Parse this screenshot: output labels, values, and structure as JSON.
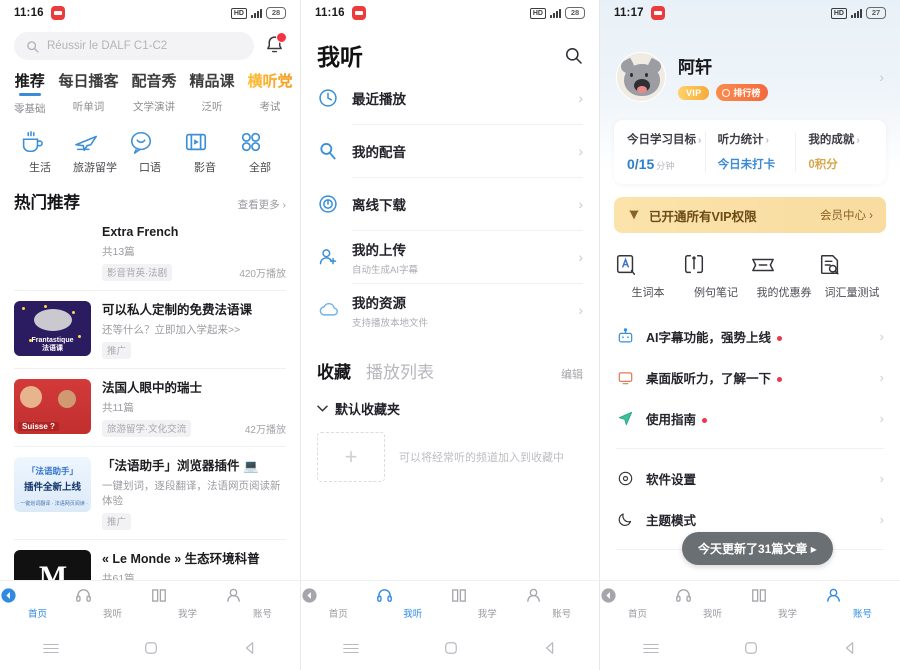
{
  "screens": [
    {
      "statusbar": {
        "time": "11:16",
        "hd": "HD",
        "battery": "28"
      },
      "search": {
        "placeholder": "Réussir le DALF C1-C2"
      },
      "tabs": [
        {
          "label": "推荐",
          "sub": "零基础",
          "active": true
        },
        {
          "label": "每日播客",
          "sub": "听单词",
          "active": false
        },
        {
          "label": "配音秀",
          "sub": "文学演讲",
          "active": false
        },
        {
          "label": "精品课",
          "sub": "泛听",
          "active": false
        },
        {
          "label": "横听党",
          "sub": "考试",
          "active": false,
          "promo": true
        }
      ],
      "categories": [
        {
          "label": "生活",
          "icon": "cup-icon"
        },
        {
          "label": "旅游留学",
          "icon": "plane-icon"
        },
        {
          "label": "口语",
          "icon": "speech-bubble-icon"
        },
        {
          "label": "影音",
          "icon": "film-icon"
        },
        {
          "label": "全部",
          "icon": "grid-icon"
        }
      ],
      "section": {
        "title": "热门推荐",
        "more": "查看更多"
      },
      "items": [
        {
          "title": "Extra French",
          "sub": "共13篇",
          "chip": "影音背英·法剧",
          "plays": "420万播放",
          "thumb": "th-extra"
        },
        {
          "title": "可以私人定制的免费法语课",
          "sub": "还等什么？立即加入学起来>>",
          "chip": "推广",
          "plays": "",
          "thumb": "th-frant"
        },
        {
          "title": "法国人眼中的瑞士",
          "sub": "共11篇",
          "chip": "旅游留学·文化交流",
          "plays": "42万播放",
          "thumb": "th-suisse"
        },
        {
          "title": "「法语助手」浏览器插件 💻",
          "sub": "一键划词，逐段翻译，法语网页阅读新体验",
          "chip": "推广",
          "plays": "",
          "thumb": "th-plugin"
        },
        {
          "title": "« Le Monde » 生态环境科普",
          "sub": "共61篇",
          "chip": "",
          "plays": "",
          "thumb": "th-monde"
        }
      ],
      "bottomnav": [
        {
          "label": "首页",
          "icon": "home-icon",
          "active": true
        },
        {
          "label": "我听",
          "icon": "headphone-icon",
          "active": false
        },
        {
          "label": "我学",
          "icon": "book-icon",
          "active": false
        },
        {
          "label": "账号",
          "icon": "person-icon",
          "active": false
        }
      ]
    },
    {
      "statusbar": {
        "time": "11:16",
        "hd": "HD",
        "battery": "28"
      },
      "title": "我听",
      "search_icon": "search-icon",
      "menu": [
        {
          "label": "最近播放",
          "sub": "",
          "icon": "clock-icon"
        },
        {
          "label": "我的配音",
          "sub": "",
          "icon": "mic-search-icon"
        },
        {
          "label": "离线下载",
          "sub": "",
          "icon": "download-circle-icon"
        },
        {
          "label": "我的上传",
          "sub": "自动生成AI字幕",
          "icon": "user-upload-icon"
        },
        {
          "label": "我的资源",
          "sub": "支持播放本地文件",
          "icon": "cloud-icon"
        }
      ],
      "fav": {
        "tab1": "收藏",
        "tab2": "播放列表",
        "edit": "编辑",
        "folder": "默认收藏夹",
        "empty_text": "可以将经常听的频道加入到收藏中",
        "add": "+"
      },
      "bottomnav": [
        {
          "label": "首页",
          "icon": "home-icon",
          "active": false
        },
        {
          "label": "我听",
          "icon": "headphone-icon",
          "active": true
        },
        {
          "label": "我学",
          "icon": "book-icon",
          "active": false
        },
        {
          "label": "账号",
          "icon": "person-icon",
          "active": false
        }
      ]
    },
    {
      "statusbar": {
        "time": "11:17",
        "hd": "HD",
        "battery": "27"
      },
      "profile": {
        "name": "阿轩",
        "vip_badge": "VIP",
        "rank_badge": "排行榜"
      },
      "stats": [
        {
          "header": "今日学习目标",
          "value": "0/15",
          "unit": "分钟",
          "style": "big"
        },
        {
          "header": "听力统计",
          "value": "今日未打卡",
          "unit": "",
          "style": "blue"
        },
        {
          "header": "我的成就",
          "value": "0积分",
          "unit": "",
          "style": "gold"
        }
      ],
      "vipbar": {
        "text": "已开通所有VIP权限",
        "right": "会员中心"
      },
      "quick": [
        {
          "label": "生词本",
          "icon": "vocabulary-book-icon"
        },
        {
          "label": "例句笔记",
          "icon": "note-icon"
        },
        {
          "label": "我的优惠券",
          "icon": "coupon-icon"
        },
        {
          "label": "词汇量测试",
          "icon": "vocab-test-icon"
        }
      ],
      "rows": [
        {
          "label": "AI字幕功能，强势上线",
          "icon": "robot-icon",
          "dot": true,
          "group": 1
        },
        {
          "label": "桌面版听力，了解一下",
          "icon": "monitor-icon",
          "dot": true,
          "group": 1
        },
        {
          "label": "使用指南",
          "icon": "paper-plane-icon",
          "dot": true,
          "group": 1
        },
        {
          "label": "软件设置",
          "icon": "gear-icon",
          "dot": false,
          "group": 2
        },
        {
          "label": "主题模式",
          "icon": "moon-icon",
          "dot": false,
          "group": 2
        }
      ],
      "toast": "今天更新了31篇文章",
      "bottomnav": [
        {
          "label": "首页",
          "icon": "home-icon",
          "active": false
        },
        {
          "label": "我听",
          "icon": "headphone-icon",
          "active": false
        },
        {
          "label": "我学",
          "icon": "book-icon",
          "active": false
        },
        {
          "label": "账号",
          "icon": "person-icon",
          "active": true
        }
      ]
    }
  ],
  "sysnav": {
    "menu": "menu-icon",
    "home": "home-square-icon",
    "back": "back-triangle-icon"
  },
  "colors": {
    "accent": "#2f8ae0",
    "promo_gold": "#f5ab3a",
    "alert_red": "#f0344a"
  }
}
